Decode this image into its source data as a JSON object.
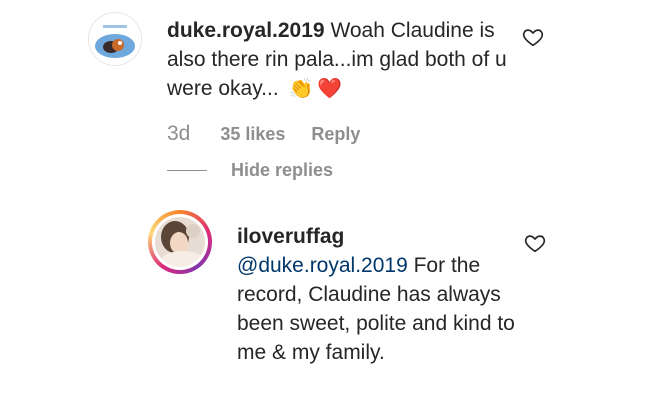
{
  "comment": {
    "username": "duke.royal.2019",
    "text": "Woah Claudine is also there rin pala...im glad both of u were okay...",
    "emojis": [
      "👏",
      "❤️"
    ],
    "age": "3d",
    "likes": "35 likes",
    "reply_label": "Reply",
    "hide_replies_label": "Hide replies",
    "avatar_icon": "avatar-cartoon-icon",
    "like_icon": "heart-outline-icon"
  },
  "reply": {
    "username": "iloveruffag",
    "mention": "@duke.royal.2019",
    "text": "For the record, Claudine has always been sweet, polite and kind to me & my family.",
    "avatar_icon": "avatar-photo-icon",
    "like_icon": "heart-outline-icon"
  },
  "colors": {
    "text": "#262626",
    "muted": "#8e8e8e",
    "mention": "#00376b",
    "story_ring": [
      "#f58529",
      "#dd2a7b",
      "#8134af"
    ]
  }
}
